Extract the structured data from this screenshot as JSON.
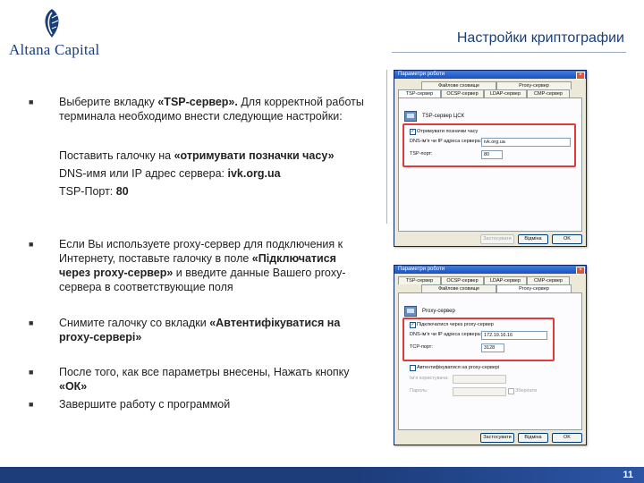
{
  "brand": {
    "name": "Altana Capital"
  },
  "title": "Настройки криптографии",
  "colors": {
    "brand_blue": "#1a3e78",
    "footer_blue": "#1d3c7a",
    "highlight_red": "#e03a3a"
  },
  "instructions": {
    "b1": {
      "pre": "Выберите вкладку ",
      "bold": "«TSP-сервер».",
      "post": " Для корректной работы терминала необходимо внести следующие настройки:"
    },
    "p1": {
      "pre": "Поставить галочку на ",
      "bold": "«отримувати позначки часу»"
    },
    "p2": {
      "pre": "DNS-имя или IP адрес сервера: ",
      "bold": "ivk.org.ua"
    },
    "p3": {
      "pre": "TSP-Порт: ",
      "bold": "80"
    },
    "b2": {
      "pre": "Если Вы используете proxy-сервер для подключения к Интернету, поставьте галочку в поле ",
      "bold": "«Підключатися через proxy-сервер»",
      "post": " и введите данные Вашего proxy-сервера в соответствующие поля"
    },
    "b3": {
      "pre": "Снимите галочку со вкладки ",
      "bold": "«Автентифікуватися на proxy-сервері»"
    },
    "b4": {
      "pre": "После того, как все параметры внесены, Нажать кнопку ",
      "bold": "«ОК»"
    },
    "b5": {
      "text": "Завершите работу с программой"
    }
  },
  "dialog1": {
    "title": "Параметри роботи",
    "tabs_top": [
      "Файлове сховище",
      "Proxy-сервер"
    ],
    "tabs_bottom": [
      "TSP-сервер",
      "OCSP-сервер",
      "LDAP-сервер",
      "CMP-сервер"
    ],
    "heading": "TSP-сервер ЦСК",
    "checkbox_label": "Отримувати позначки часу",
    "dns_label": "DNS-ім'я чи IP адреса сервера:",
    "dns_value": "ivk.org.ua",
    "port_label": "TSP-порт:",
    "port_value": "80",
    "btn_apply": "Застосувати",
    "btn_cancel": "Відміна",
    "btn_ok": "OK"
  },
  "dialog2": {
    "title": "Параметри роботи",
    "tabs_top": [
      "TSP-сервер",
      "OCSP-сервер",
      "LDAP-сервер",
      "CMP-сервер"
    ],
    "tabs_bottom": [
      "Файлове сховище",
      "Proxy-сервер"
    ],
    "heading": "Proxy-сервер",
    "checkbox_label": "Підключатися через proxy-сервер",
    "dns_label": "DNS-ім'я чи IP адреса сервера:",
    "dns_value": "172.19.16.16",
    "port_label": "TCP-порт:",
    "port_value": "3128",
    "auth_label": "Автентифікуватися на proxy-сервері",
    "user_label": "Ім'я користувача:",
    "pass_label": "Пароль:",
    "save_label": "Зберігати",
    "btn_apply": "Застосувати",
    "btn_cancel": "Відміна",
    "btn_ok": "OK"
  },
  "page_number": "11"
}
